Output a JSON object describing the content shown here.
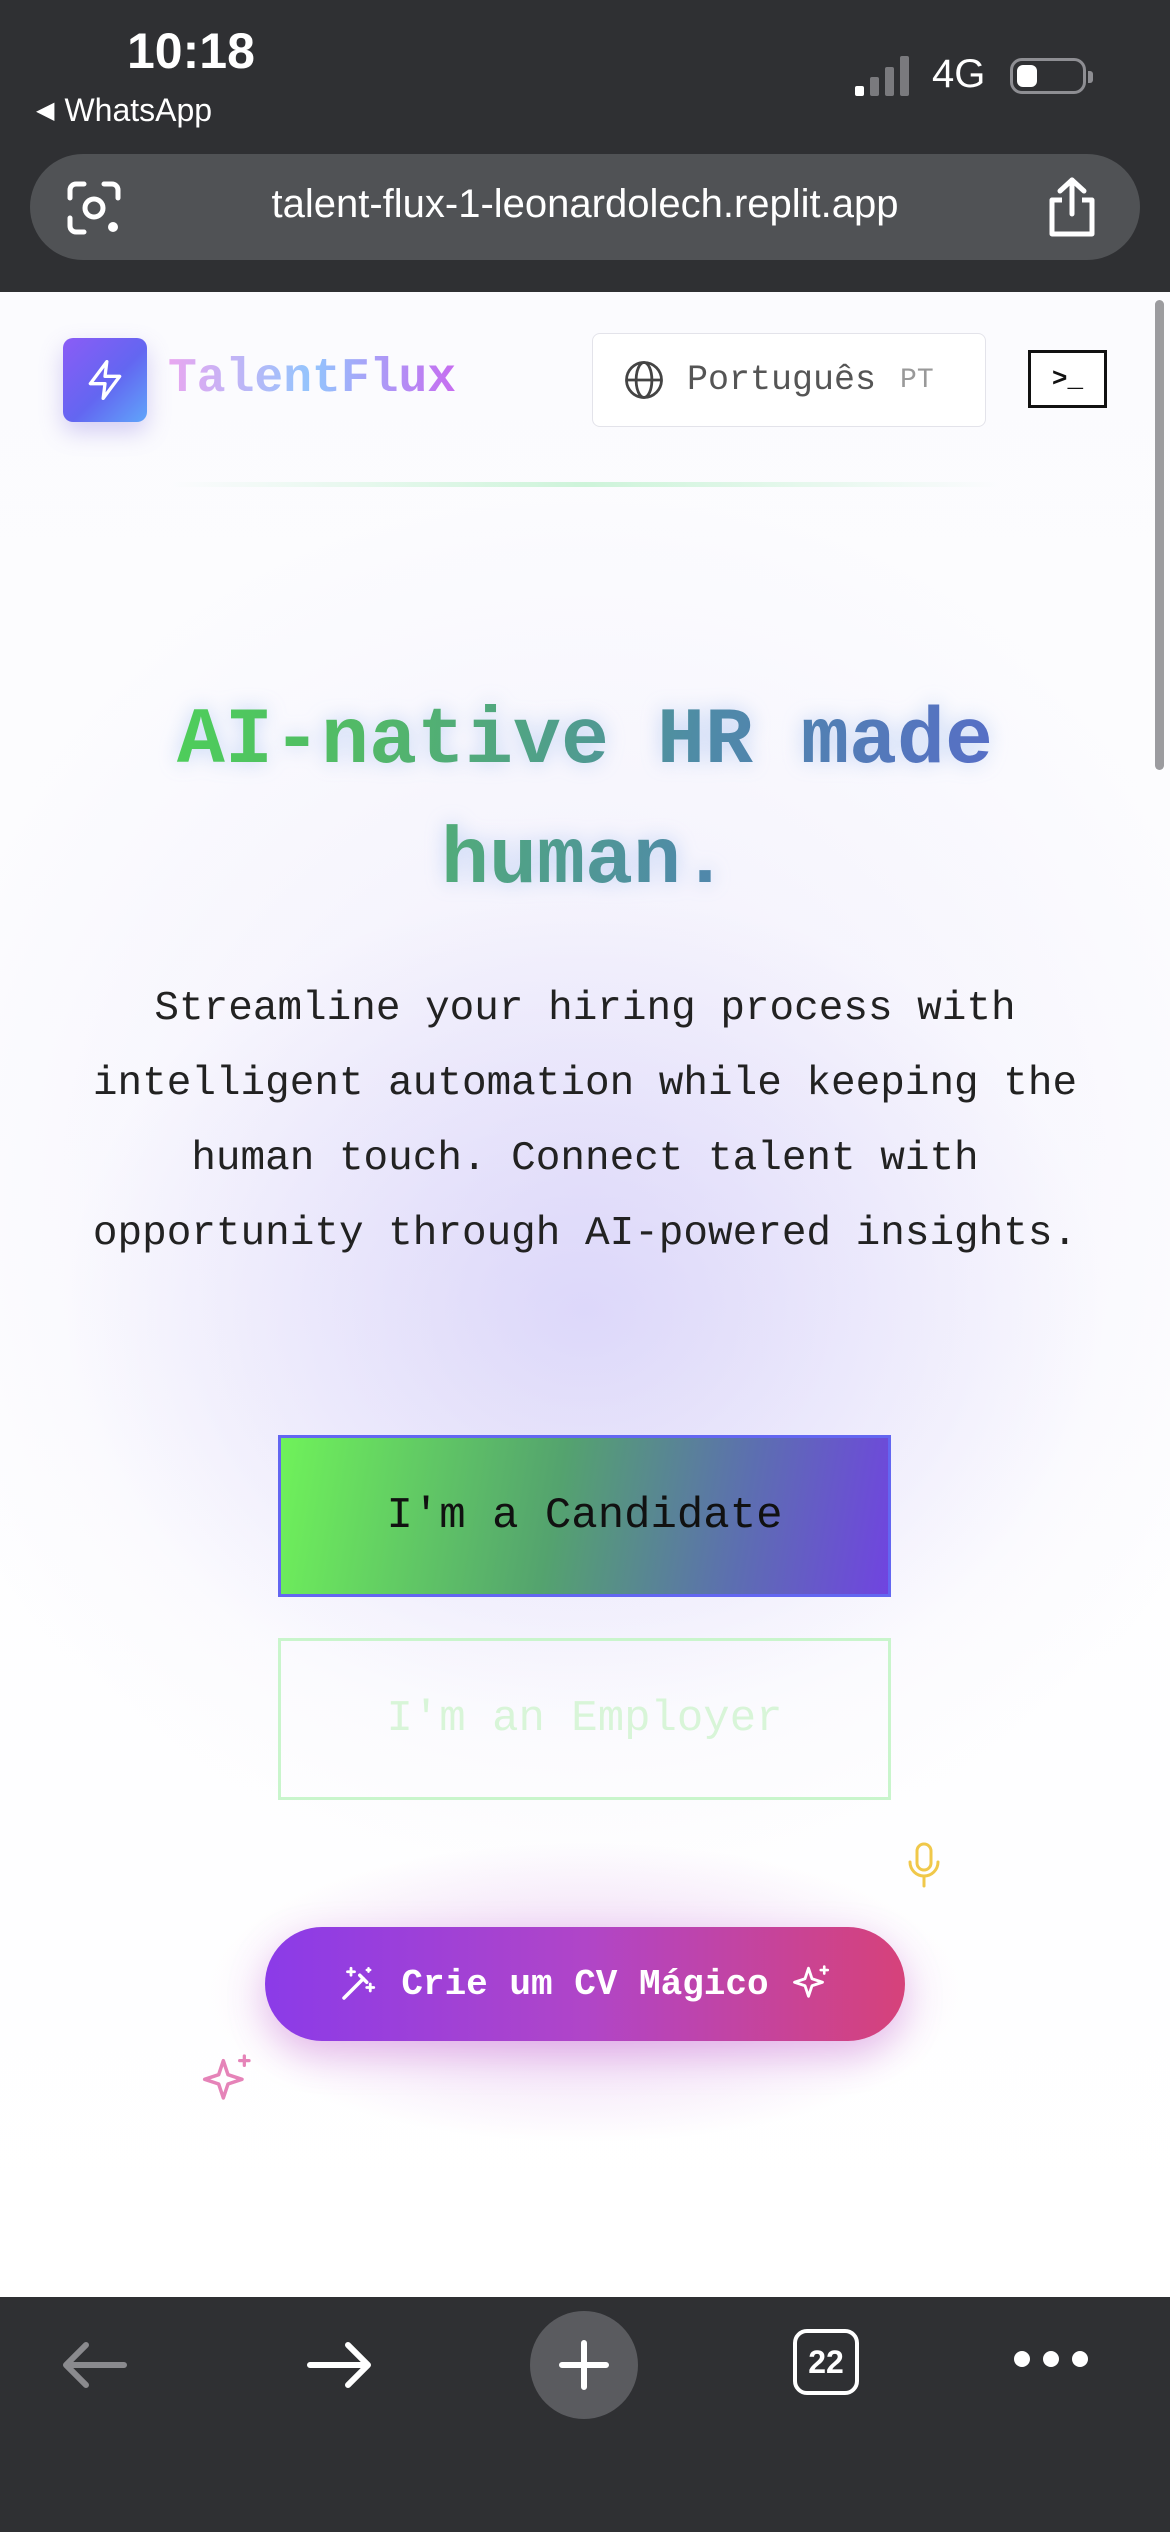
{
  "status_bar": {
    "time": "10:18",
    "back_app": "WhatsApp",
    "network": "4G"
  },
  "browser": {
    "url": "talent-flux-1-leonardolech.replit.app",
    "tab_count": "22"
  },
  "header": {
    "brand": "TalentFlux",
    "language_label": "Português",
    "language_code": "PT",
    "terminal_label": ">_"
  },
  "hero": {
    "title": "AI-native HR made human.",
    "subtitle": "Streamline your hiring process with intelligent automation while keeping the human touch. Connect talent with opportunity through AI-powered insights.",
    "candidate_button": "I'm a Candidate",
    "employer_button": "I'm an Employer",
    "magic_cv_button": "Crie um CV Mágico"
  },
  "colors": {
    "chrome_bg": "#2f3033",
    "url_pill_bg": "#505255",
    "accent_green": "#4ade50",
    "accent_purple": "#6366f1",
    "magic_start": "#8b3be8",
    "magic_end": "#d6427a"
  },
  "icons": {
    "logo": "lightning-icon",
    "lens": "camera-lens-icon",
    "share": "share-icon",
    "language": "globe-icon",
    "magic_left": "magic-wand-icon",
    "magic_right": "sparkles-icon",
    "voice": "microphone-icon"
  }
}
